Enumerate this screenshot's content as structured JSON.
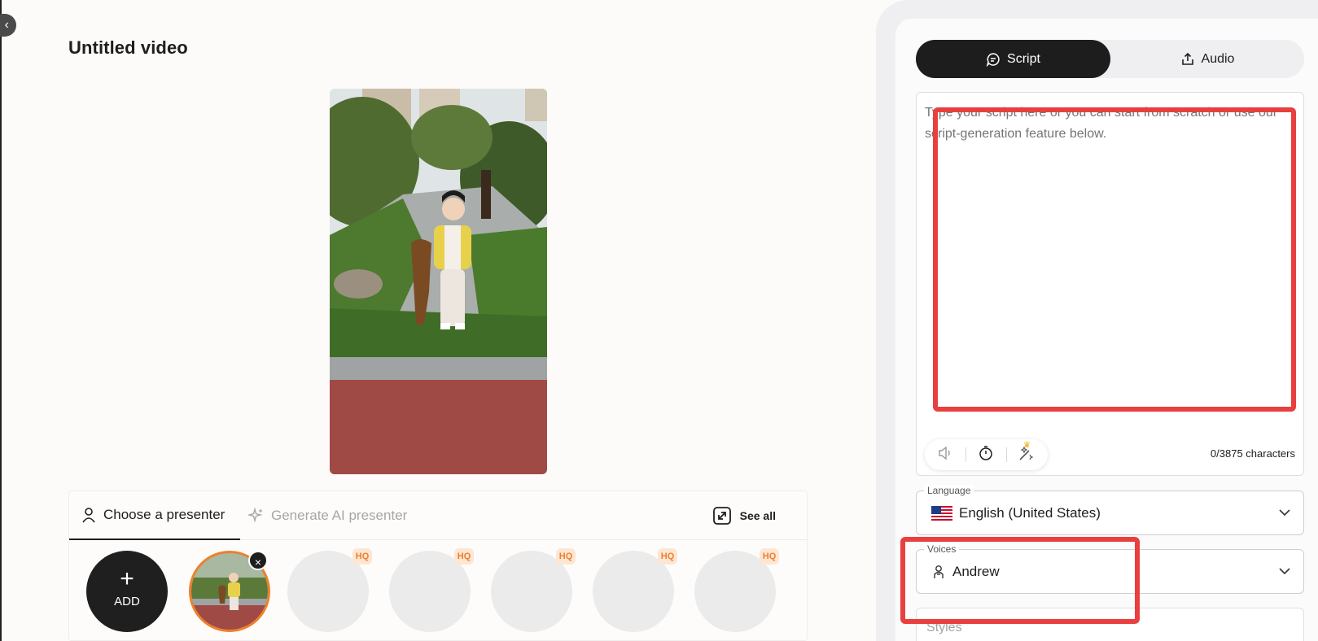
{
  "page_title": "Untitled video",
  "presenter_tabs": {
    "choose": "Choose a presenter",
    "generate": "Generate AI presenter",
    "see_all": "See all"
  },
  "avatar_row": {
    "add_label": "ADD",
    "add_symbol": "+",
    "remove_symbol": "×",
    "hq_badges": [
      "HQ",
      "HQ",
      "HQ",
      "HQ",
      "HQ"
    ]
  },
  "right_panel": {
    "tabs": {
      "script": "Script",
      "audio": "Audio"
    },
    "script_placeholder": "Type your script here or you can start from scratch or use our script-generation feature below.",
    "char_count": "0/3875 characters",
    "language": {
      "label": "Language",
      "value": "English (United States)"
    },
    "voices": {
      "label": "Voices",
      "value": "Andrew"
    },
    "styles_placeholder": "Styles"
  },
  "colors": {
    "accent_orange": "#f07f2a",
    "highlight_red": "#e8403f",
    "dark": "#1d1d1d"
  },
  "icons": {
    "collapse": "chevron-left-icon",
    "presenter": "person-icon",
    "generate": "sparkle-icon",
    "see_all": "expand-icon",
    "script": "chat-bubble-icon",
    "audio": "upload-icon",
    "tools": [
      "speaker-icon",
      "timer-icon",
      "magic-wand-icon"
    ],
    "voice": "voice-person-icon"
  }
}
